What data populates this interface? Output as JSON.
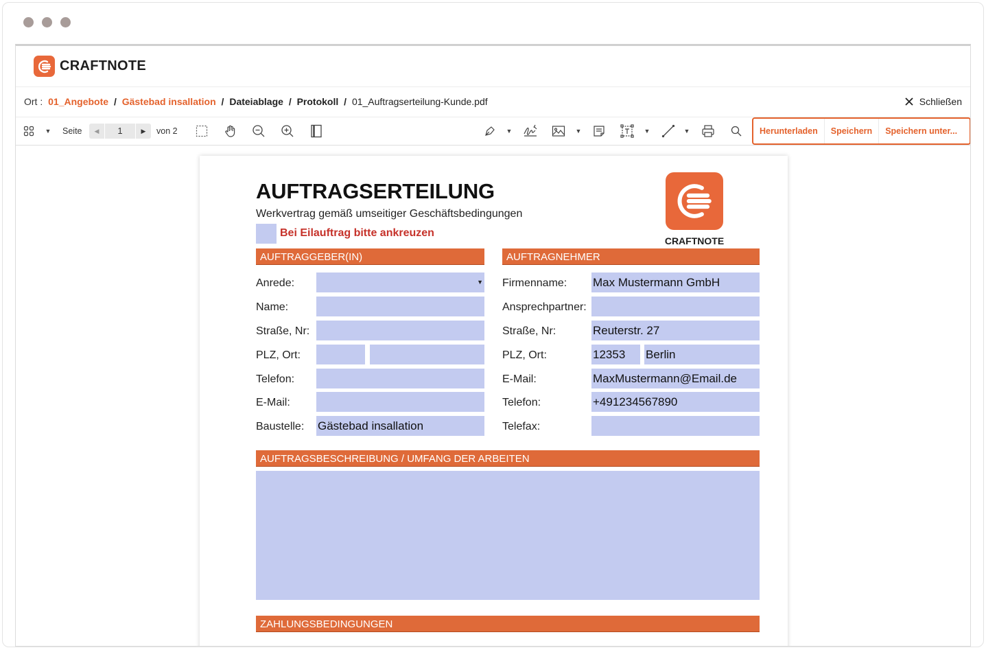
{
  "app": {
    "brand": "CRAFTNOTE"
  },
  "breadcrumb": {
    "label": "Ort :",
    "items": [
      "01_Angebote",
      "Gästebad insallation",
      "Dateiablage",
      "Protokoll",
      "01_Auftragserteilung-Kunde.pdf"
    ],
    "separator": "/"
  },
  "close": {
    "label": "Schließen"
  },
  "toolbar": {
    "page_label": "Seite",
    "page_current": "1",
    "page_total": "von 2",
    "actions": [
      "Herunterladen",
      "Speichern",
      "Speichern unter..."
    ]
  },
  "document": {
    "title": "AUFTRAGSERTEILUNG",
    "subtitle": "Werkvertrag gemäß umseitiger Geschäftsbedingungen",
    "rush_label": "Bei Eilauftrag bitte ankreuzen",
    "logo_text": "CRAFTNOTE",
    "client_section": "AUFTRAGGEBER(IN)",
    "contractor_section": "AUFTRAGNEHMER",
    "client_fields": {
      "salutation": {
        "label": "Anrede:",
        "value": ""
      },
      "name": {
        "label": "Name:",
        "value": ""
      },
      "street": {
        "label": "Straße, Nr:",
        "value": ""
      },
      "zip_city": {
        "label": "PLZ, Ort:",
        "zip": "",
        "city": ""
      },
      "phone": {
        "label": "Telefon:",
        "value": ""
      },
      "email": {
        "label": "E-Mail:",
        "value": ""
      },
      "site": {
        "label": "Baustelle:",
        "value": "Gästebad insallation"
      }
    },
    "contractor_fields": {
      "company": {
        "label": "Firmenname:",
        "value": "Max Mustermann GmbH"
      },
      "contact": {
        "label": "Ansprechpartner:",
        "value": ""
      },
      "street": {
        "label": "Straße, Nr:",
        "value": "Reuterstr. 27"
      },
      "zip_city": {
        "label": "PLZ, Ort:",
        "zip": "12353",
        "city": "Berlin"
      },
      "email": {
        "label": "E-Mail:",
        "value": "MaxMustermann@Email.de"
      },
      "phone": {
        "label": "Telefon:",
        "value": "+491234567890"
      },
      "fax": {
        "label": "Telefax:",
        "value": ""
      }
    },
    "description_section": "AUFTRAGSBESCHREIBUNG / UMFANG DER ARBEITEN",
    "description_value": "",
    "payment_section": "ZAHLUNGSBEDINGUNGEN"
  },
  "colors": {
    "accent": "#e4622c",
    "section_bar": "#df6a39",
    "field_fill": "#c3cbf0",
    "rush_text": "#c6322a"
  },
  "icons": [
    "thumbnails-icon",
    "rectangle-select-icon",
    "pan-hand-icon",
    "zoom-out-icon",
    "zoom-in-icon",
    "page-fit-icon",
    "pen-icon",
    "signature-icon",
    "image-icon",
    "note-icon",
    "text-box-icon",
    "line-icon",
    "print-icon",
    "search-icon",
    "close-icon"
  ]
}
